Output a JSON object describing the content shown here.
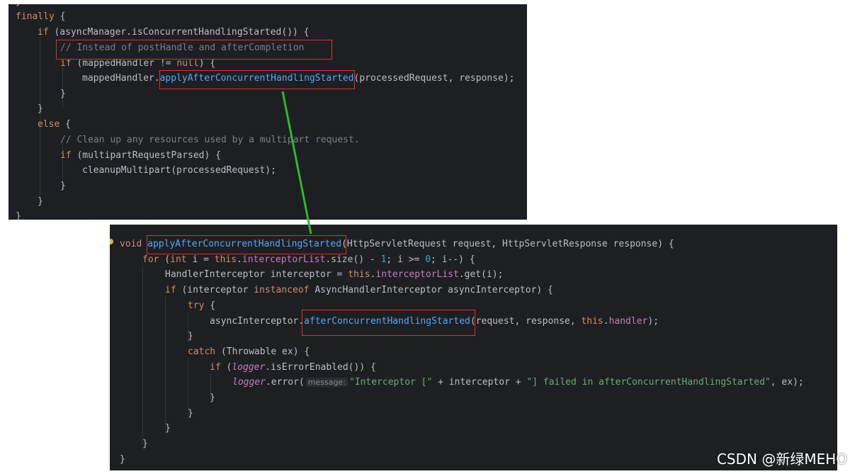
{
  "top_code": {
    "l0": "}",
    "l1_kw": "finally",
    "l1_rest": " {",
    "l2_kw": "if",
    "l2_rest": " (asyncManager.isConcurrentHandlingStarted()) {",
    "l3_comment": "// Instead of postHandle and afterCompletion",
    "l4_kw": "if",
    "l4_a": " (mappedHandler != ",
    "l4_null": "null",
    "l4_b": ") {",
    "l5_a": "mappedHandler.",
    "l5_fn": "applyAfterConcurrentHandlingStarted",
    "l5_b": "(processedRequest, response);",
    "l6": "}",
    "l7": "}",
    "l8_kw": "else",
    "l8_rest": " {",
    "l9_comment": "// Clean up any resources used by a multipart request.",
    "l10_kw": "if",
    "l10_rest": " (multipartRequestParsed) {",
    "l11": "cleanupMultipart(processedRequest);",
    "l12": "}",
    "l13": "}",
    "l14": "}"
  },
  "bottom_code": {
    "l1_kw": "void",
    "l1_fn": "applyAfterConcurrentHandlingStarted",
    "l1_rest": "(HttpServletRequest request, HttpServletResponse response) {",
    "l2_kw": "for",
    "l2_a": " (",
    "l2_int": "int",
    "l2_b": " i = ",
    "l2_this": "this",
    "l2_c": ".",
    "l2_field": "interceptorList",
    "l2_d": ".size() - ",
    "l2_one": "1",
    "l2_e": "; i >= ",
    "l2_zero": "0",
    "l2_f": "; i--) {",
    "l3_a": "HandlerInterceptor interceptor = ",
    "l3_this": "this",
    "l3_b": ".",
    "l3_field": "interceptorList",
    "l3_c": ".get(i);",
    "l4_kw": "if",
    "l4_a": " (interceptor ",
    "l4_inst": "instanceof",
    "l4_b": " AsyncHandlerInterceptor asyncInterceptor) {",
    "l5_kw": "try",
    "l5_rest": " {",
    "l6_a": "asyncInterceptor.",
    "l6_fn": "afterConcurrentHandlingStarted",
    "l6_b": "(request, response, ",
    "l6_this": "this",
    "l6_c": ".",
    "l6_field": "handler",
    "l6_d": ");",
    "l7": "}",
    "l8_kw": "catch",
    "l8_rest": " (Throwable ex) {",
    "l9_kw": "if",
    "l9_a": " (",
    "l9_logger": "logger",
    "l9_b": ".isErrorEnabled()) {",
    "l10_logger": "logger",
    "l10_a": ".error(",
    "l10_hint": "message:",
    "l10_s1": "\"Interceptor [\"",
    "l10_b": " + interceptor + ",
    "l10_s2": "\"] failed in afterConcurrentHandlingStarted\"",
    "l10_c": ", ex);",
    "l11": "}",
    "l12": "}",
    "l13": "}",
    "l14": "}",
    "l15": "}"
  },
  "watermark": "CSDN @新绿MEHO",
  "colors": {
    "background": "#1e1f22",
    "keyword": "#cf8e6d",
    "comment": "#7a7e85",
    "function": "#56a8f5",
    "string": "#6aab73",
    "number": "#2aacb8",
    "field": "#c77dbb",
    "highlight_box": "#d93131",
    "connector": "#2eb82e"
  }
}
